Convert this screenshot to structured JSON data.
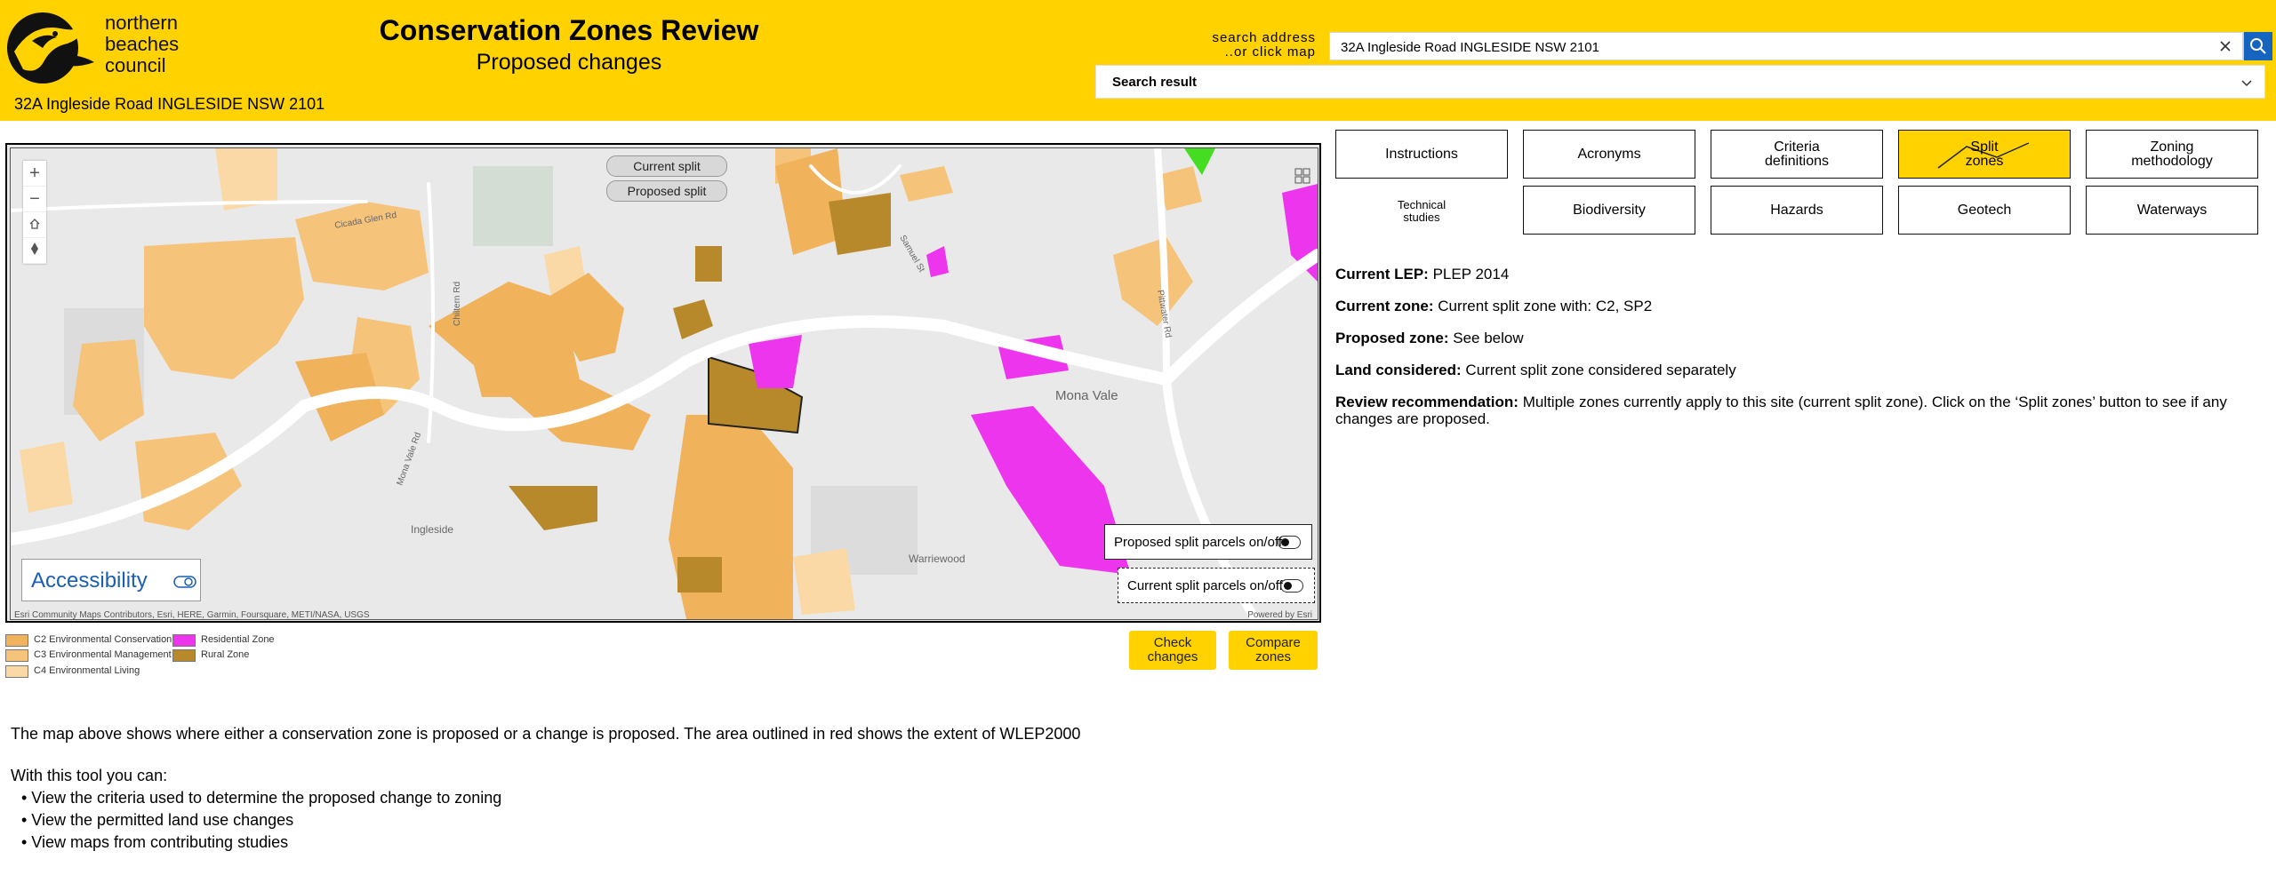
{
  "header": {
    "logo_lines": [
      "northern",
      "beaches",
      "council"
    ],
    "title": "Conservation Zones Review",
    "subtitle": "Proposed changes",
    "address": "32A Ingleside Road INGLESIDE NSW 2101"
  },
  "search": {
    "label_line1": "search address",
    "label_line2": "..or click map",
    "value": "32A Ingleside Road INGLESIDE NSW 2101",
    "result_label": "Search result"
  },
  "map": {
    "pill_current": "Current split",
    "pill_proposed": "Proposed split",
    "accessibility_label": "Accessibility",
    "toggle_proposed": "Proposed split parcels on/off",
    "toggle_current": "Current split parcels on/off",
    "attribution": "Esri Community Maps Contributors, Esri, HERE, Garmin, Foursquare, METI/NASA, USGS",
    "powered": "Powered by Esri",
    "place_labels": [
      "Mona Vale",
      "Ingleside",
      "Warriewood",
      "Mona Vale Rd",
      "Chiltern Rd",
      "Cicada Glen Rd",
      "Pittwater Rd",
      "Samuel St"
    ],
    "colors": {
      "c2": "#f0b35c",
      "c3": "#f6c37a",
      "c4": "#fbd9a6",
      "residential": "#ee35ee",
      "rural": "#b8892a",
      "base": "#e9e9e9",
      "road": "#ffffff"
    }
  },
  "legend": {
    "c2": "C2 Environmental Conservation",
    "c3": "C3 Environmental Management",
    "c4": "C4 Environmental Living",
    "residential": "Residential Zone",
    "rural": "Rural Zone"
  },
  "buttons": {
    "check_changes": "Check\nchanges",
    "compare_zones": "Compare\nzones"
  },
  "nav": {
    "instructions": "Instructions",
    "acronyms": "Acronyms",
    "criteria": "Criteria\ndefinitions",
    "split_zones": "Split\nzones",
    "zoning_methodology": "Zoning\nmethodology",
    "technical_studies": "Technical\nstudies",
    "biodiversity": "Biodiversity",
    "hazards": "Hazards",
    "geotech": "Geotech",
    "waterways": "Waterways"
  },
  "info": {
    "current_lep_label": "Current LEP:",
    "current_lep_value": "PLEP 2014",
    "current_zone_label": "Current zone:",
    "current_zone_value": "Current split zone with: C2, SP2",
    "proposed_zone_label": "Proposed zone:",
    "proposed_zone_value": "See below",
    "land_considered_label": "Land considered:",
    "land_considered_value": "Current split zone considered separately",
    "review_label": "Review recommendation:",
    "review_value": "Multiple zones currently apply to this site (current split zone). Click on the ‘Split zones’ button to see if any changes are proposed."
  },
  "body": {
    "intro": "The map above shows where either a conservation zone is proposed or a change is proposed. The area outlined in red shows the extent of WLEP2000",
    "tool_heading": "With this tool you can:",
    "bullets": [
      "• View the criteria used to determine the proposed change to zoning",
      "• View  the permitted land use changes",
      "• View maps from contributing studies"
    ]
  }
}
